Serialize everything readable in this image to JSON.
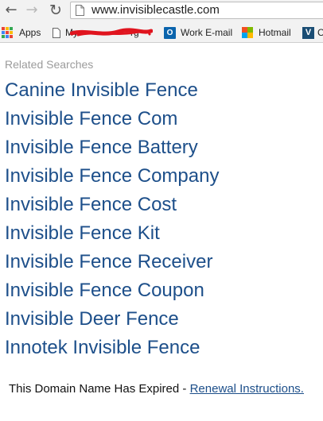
{
  "browser": {
    "url": "www.invisiblecastle.com",
    "bookmarks": {
      "apps": "Apps",
      "my_prefix": "My",
      "my_suffix": "rg",
      "work_email": "Work E-mail",
      "hotmail": "Hotmail",
      "outlook_letter": "O",
      "last_letter": "V",
      "last_fragment": "C"
    },
    "colors": {
      "toolbar": "#f2f2f2",
      "redaction": "#e0141e",
      "apps_grid": [
        "#ea4335",
        "#fbbc05",
        "#34a853",
        "#4285f4",
        "#ea4335",
        "#fbbc05",
        "#34a853",
        "#4285f4",
        "#ea4335"
      ],
      "ms_logo": [
        "#f25022",
        "#7fba00",
        "#00a4ef",
        "#ffb900"
      ]
    }
  },
  "page": {
    "related_heading": "Related Searches",
    "links": [
      "Canine Invisible Fence",
      "Invisible Fence Com",
      "Invisible Fence Battery",
      "Invisible Fence Company",
      "Invisible Fence Cost",
      "Invisible Fence Kit",
      "Invisible Fence Receiver",
      "Invisible Fence Coupon",
      "Invisible Deer Fence",
      "Innotek Invisible Fence"
    ],
    "footer_text": "This Domain Name Has Expired - ",
    "footer_link": "Renewal Instructions.",
    "link_color": "#1d4f8a"
  }
}
